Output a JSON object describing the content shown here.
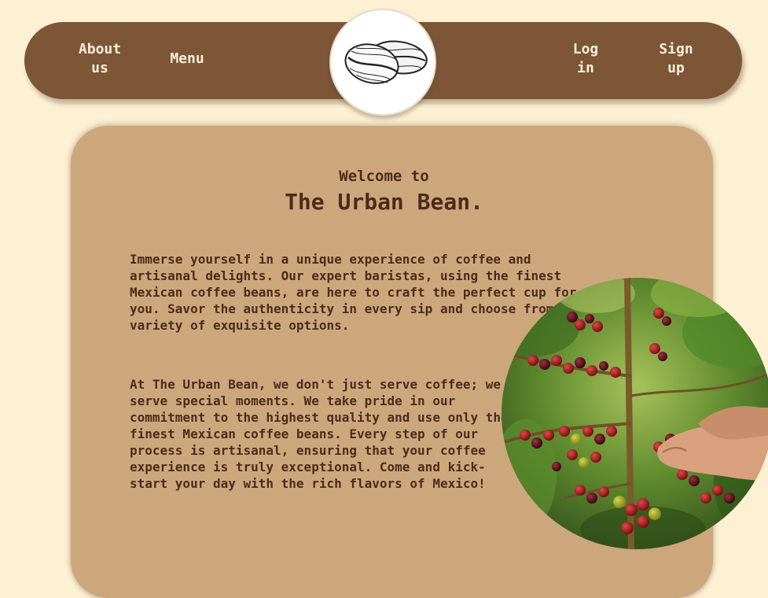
{
  "nav": {
    "about_label": "About us",
    "menu_label": "Menu",
    "login_label": "Log in",
    "signup_label": "Sign up"
  },
  "logo": {
    "icon": "coffee-bean-logo"
  },
  "hero": {
    "welcome": "Welcome to",
    "title": "The Urban Bean.",
    "paragraph1": "Immerse yourself in a unique experience of coffee and artisanal delights. Our expert baristas, using the finest Mexican coffee beans, are here to craft the perfect cup for you. Savor the authenticity in every sip and choose from a variety of exquisite options.",
    "paragraph2": "At The Urban Bean, we don't just serve coffee; we serve special moments. We take pride in our commitment to the highest quality and use only the finest Mexican coffee beans. Every step of our process is artisanal, ensuring that your coffee experience is truly exceptional. Come and kick-start your day with the rich flavors of Mexico!"
  },
  "colors": {
    "page_background": "#fdf0d3",
    "navbar": "#7d5638",
    "card": "#cda77c",
    "text": "#4a2c1c",
    "nav_text": "#fbeed8"
  }
}
